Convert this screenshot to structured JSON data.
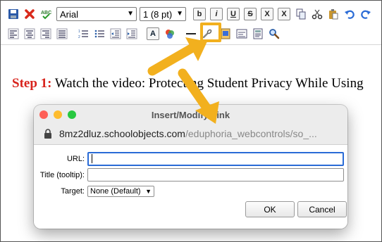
{
  "toolbar": {
    "font_name": "Arial",
    "font_size": "1 (8 pt)",
    "bold_label": "b",
    "italic_label": "i",
    "underline_label": "U",
    "strike_label": "S",
    "subscript_label": "X",
    "superscript_label": "X",
    "font_color_label": "A"
  },
  "content": {
    "step_label": "Step 1:",
    "step_text": " Watch the video: Protecting Student Privacy While Using"
  },
  "dialog": {
    "title": "Insert/Modify Link",
    "url_host": "8mz2dluz.schoolobjects.com",
    "url_path": "/eduphoria_webcontrols/so_...",
    "url_label": "URL:",
    "url_value": "",
    "title_label": "Title (tooltip):",
    "title_value": "",
    "target_label": "Target:",
    "target_value": "None (Default)",
    "ok_label": "OK",
    "cancel_label": "Cancel"
  },
  "colors": {
    "highlight": "#f2b01e",
    "step_red": "#d8231c",
    "focus_blue": "#2a6bd6"
  },
  "icons": [
    "save-icon",
    "delete-icon",
    "spellcheck-icon",
    "copy-icon",
    "cut-icon",
    "paste-icon",
    "undo-icon",
    "redo-icon",
    "align-left-icon",
    "align-center-icon",
    "align-right-icon",
    "justify-icon",
    "numbered-list-icon",
    "bullet-list-icon",
    "outdent-icon",
    "indent-icon",
    "palette-icon",
    "horizontal-rule-icon",
    "link-icon",
    "image-icon",
    "table-icon",
    "template-icon",
    "zoom-icon",
    "lock-icon"
  ]
}
